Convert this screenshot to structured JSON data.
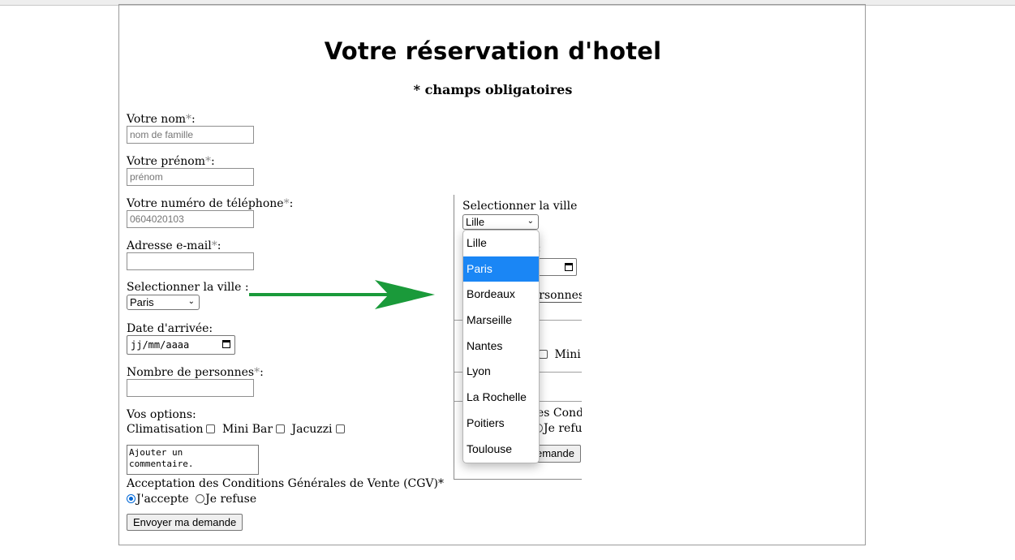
{
  "form": {
    "title": "Votre réservation d'hotel",
    "required_note": "* champs obligatoires",
    "nom_label": "Votre nom",
    "nom_placeholder": "nom de famille",
    "prenom_label": "Votre prénom",
    "prenom_placeholder": "prénom",
    "tel_label": "Votre numéro de téléphone",
    "tel_placeholder": "0604020103",
    "email_label": "Adresse e-mail",
    "email_value": "",
    "ville_label": "Selectionner la ville :",
    "ville_selected": "Paris",
    "date_label": "Date d'arrivée:",
    "date_placeholder": "jj/mm/aaaa",
    "personnes_label": "Nombre de personnes",
    "personnes_value": "",
    "options_label": "Vos options:",
    "option_clim": "Climatisation",
    "option_minibar": "Mini Bar",
    "option_jacuzzi": "Jacuzzi",
    "comment_placeholder": "Ajouter un\ncommentaire.",
    "cgv_label": "Acceptation des Conditions Générales de Vente (CGV)",
    "accept_label": "J'accepte",
    "refuse_label": "Je refuse",
    "submit_label": "Envoyer ma demande",
    "required_mark": "*",
    "colon": ":"
  },
  "zoom": {
    "ville_label": "Selectionner la ville :",
    "ville_selected": "Lille",
    "colon_fragment": ":",
    "personnes_fragment": "ersonnes",
    "mini_fragment": "Mini",
    "conditions_fragment": "es Condi",
    "refuse_fragment": "Je refus",
    "submit_fragment": "emande",
    "options": [
      "Lille",
      "Paris",
      "Bordeaux",
      "Marseille",
      "Nantes",
      "Lyon",
      "La Rochelle",
      "Poitiers",
      "Toulouse"
    ],
    "highlighted_index": 1
  },
  "colors": {
    "arrow": "#1a9a3a",
    "highlight": "#1a86f5",
    "radio_checked": "#0067d6"
  }
}
